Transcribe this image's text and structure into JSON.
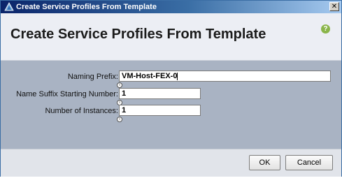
{
  "window": {
    "title": "Create Service Profiles From Template",
    "close_glyph": "✕",
    "app_icon": "app-icon"
  },
  "header": {
    "title": "Create Service Profiles From Template",
    "help_glyph": "?",
    "help_color": "#8ab54a"
  },
  "form": {
    "naming_prefix": {
      "label": "Naming Prefix:",
      "value": "VM-Host-FEX-0"
    },
    "suffix_start": {
      "label": "Name Suffix Starting Number:",
      "value": "1"
    },
    "instances": {
      "label": "Number of Instances:",
      "value": "1"
    },
    "info_glyph": "i"
  },
  "footer": {
    "ok_label": "OK",
    "cancel_label": "Cancel"
  }
}
